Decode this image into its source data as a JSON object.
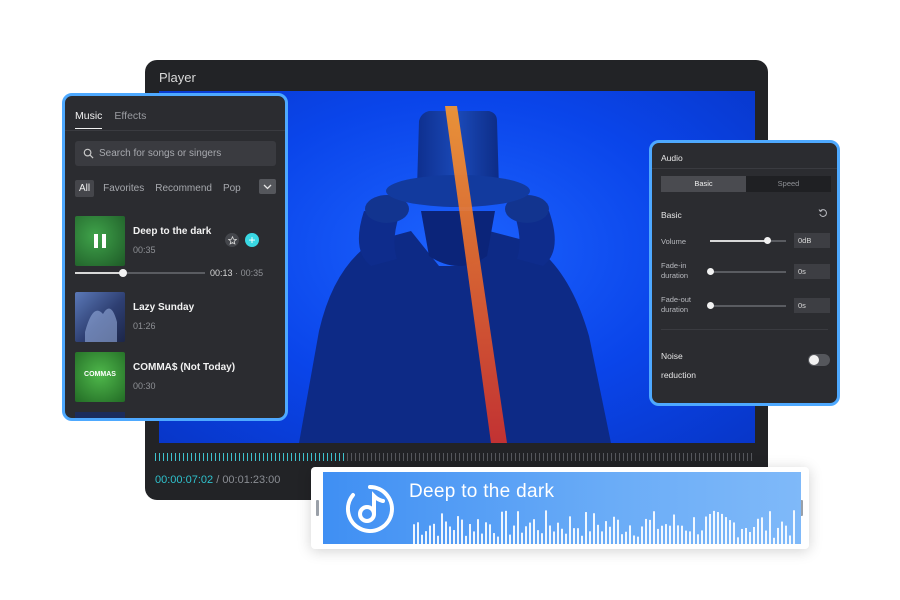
{
  "player": {
    "title": "Player",
    "timecode_current": "00:00:07:02",
    "timecode_separator": "/",
    "timecode_total": "00:01:23:00"
  },
  "music": {
    "tabs": [
      {
        "label": "Music",
        "active": true
      },
      {
        "label": "Effects",
        "active": false
      }
    ],
    "search_placeholder": "Search for songs or singers",
    "filters": [
      {
        "label": "All",
        "active": true
      },
      {
        "label": "Favorites",
        "active": false
      },
      {
        "label": "Recommend",
        "active": false
      },
      {
        "label": "Pop",
        "active": false
      }
    ],
    "tracks": [
      {
        "title": "Deep to the dark",
        "duration": "00:35",
        "playing": true
      },
      {
        "title": "Lazy Sunday",
        "duration": "01:26"
      },
      {
        "title": "COMMA$ (Not Today)",
        "duration": "00:30",
        "cover_text": "COMMAS"
      }
    ],
    "progress": {
      "current": "00:13",
      "separator": "·",
      "total": "00:35",
      "fraction": 0.37
    }
  },
  "audio": {
    "title": "Audio",
    "tabs": [
      {
        "label": "Basic",
        "active": true
      },
      {
        "label": "Speed",
        "active": false
      }
    ],
    "section": "Basic",
    "rows": [
      {
        "label": "Volume",
        "value": "0dB",
        "fraction": 0.75
      },
      {
        "label": "Fade-in duration",
        "value": "0s",
        "fraction": 0.0
      },
      {
        "label": "Fade-out duration",
        "value": "0s",
        "fraction": 0.0
      }
    ],
    "noise_label": "Noise reduction",
    "noise_enabled": false
  },
  "now_playing": {
    "title": "Deep to the dark"
  },
  "colors": {
    "accent_blue": "#4ea9ff",
    "teal": "#39d8e3",
    "video_blue": "#0a45ea",
    "panel_bg": "#2b2c30"
  }
}
